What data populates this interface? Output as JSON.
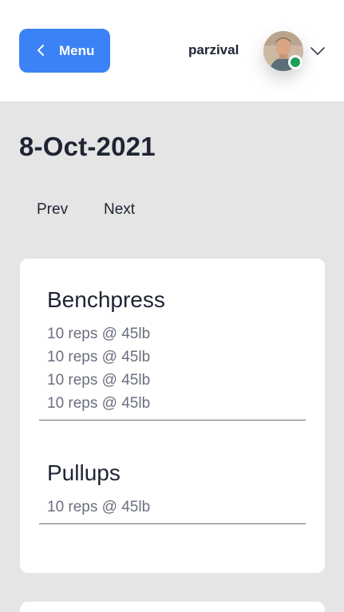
{
  "header": {
    "menu_label": "Menu",
    "username": "parzival",
    "colors": {
      "menu_button": "#3b82f6",
      "status_online": "#1f9d55"
    },
    "icons": {
      "menu": "chevron-left-icon",
      "dropdown": "chevron-down-icon"
    }
  },
  "main": {
    "date": "8-Oct-2021",
    "prev_label": "Prev",
    "next_label": "Next",
    "exercises": [
      {
        "name": "Benchpress",
        "sets": [
          "10 reps @ 45lb",
          "10 reps @ 45lb",
          "10 reps @ 45lb",
          "10 reps @ 45lb"
        ]
      },
      {
        "name": "Pullups",
        "sets": [
          "10 reps @ 45lb"
        ]
      }
    ]
  }
}
